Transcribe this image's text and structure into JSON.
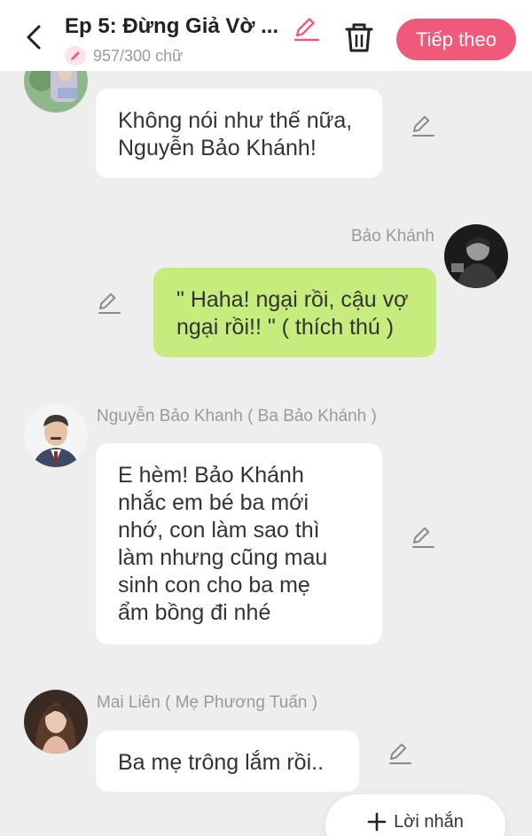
{
  "header": {
    "title": "Ep 5: Đừng Giả Vờ ...",
    "word_count": "957/300 chữ",
    "next_label": "Tiếp theo",
    "accent_color": "#f05a7a"
  },
  "icons": {
    "back": "chevron-left-icon",
    "edit": "pencil-icon",
    "delete": "trash-icon",
    "add": "plus-icon"
  },
  "messages": [
    {
      "side": "left",
      "sender": "",
      "text": "Không nói như thế nữa,\nNguyễn Bảo Khánh!"
    },
    {
      "side": "right",
      "sender": "Bảo Khánh",
      "text": "\" Haha! ngại rồi, cậu vợ\nngại rồi!! \" ( thích thú )"
    },
    {
      "side": "left",
      "sender": "Nguyễn Bảo Khanh ( Ba Bảo Khánh )",
      "text": "E hèm! Bảo Khánh\nnhắc em bé ba mới\nnhớ, con làm sao thì\nlàm nhưng cũng mau\nsinh con cho ba mẹ\nẩm bồng đi nhé"
    },
    {
      "side": "left",
      "sender": "Mai Liên ( Mẹ Phương Tuấn )",
      "text": "Ba mẹ trông lắm rồi.."
    }
  ],
  "fab": {
    "label": "Lời nhắn"
  },
  "colors": {
    "background": "#eeeeee",
    "left_bubble": "#ffffff",
    "right_bubble": "#c7ec7e"
  }
}
